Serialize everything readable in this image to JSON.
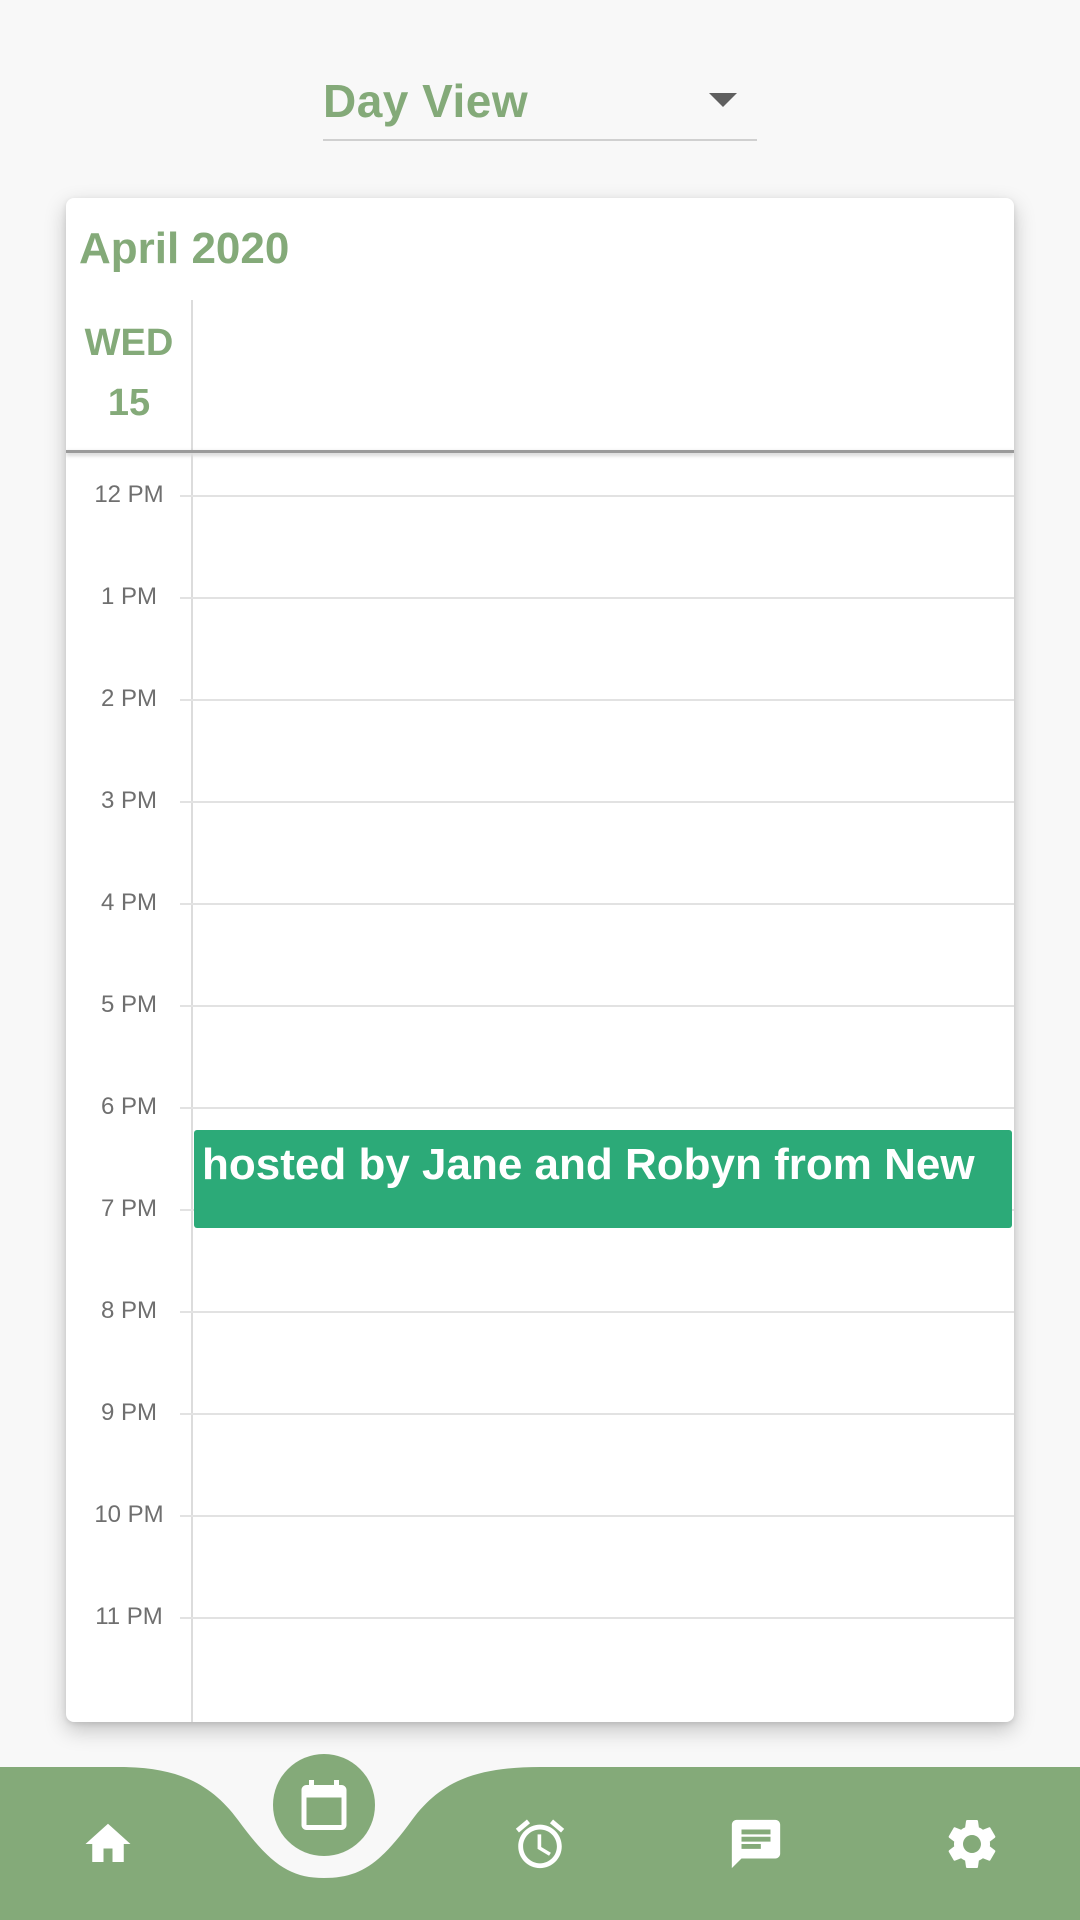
{
  "view_selector": {
    "value": "Day View"
  },
  "calendar": {
    "month_title": "April 2020",
    "day_name": "WED",
    "day_number": "15",
    "hours": [
      "12 PM",
      "1 PM",
      "2 PM",
      "3 PM",
      "4 PM",
      "5 PM",
      "6 PM",
      "7 PM",
      "8 PM",
      "9 PM",
      "10 PM",
      "11 PM"
    ],
    "event": {
      "title": "hosted by Jane and Robyn from New",
      "color": "#2caa78"
    }
  },
  "bottom_nav": {
    "items": [
      {
        "icon": "home-icon",
        "active": false
      },
      {
        "icon": "calendar-icon",
        "active": true
      },
      {
        "icon": "alarm-clock-icon",
        "active": false
      },
      {
        "icon": "message-icon",
        "active": false
      },
      {
        "icon": "gear-icon",
        "active": false
      }
    ]
  },
  "colors": {
    "accent": "#84aa79",
    "event": "#2caa78",
    "background": "#f8f8f8"
  }
}
